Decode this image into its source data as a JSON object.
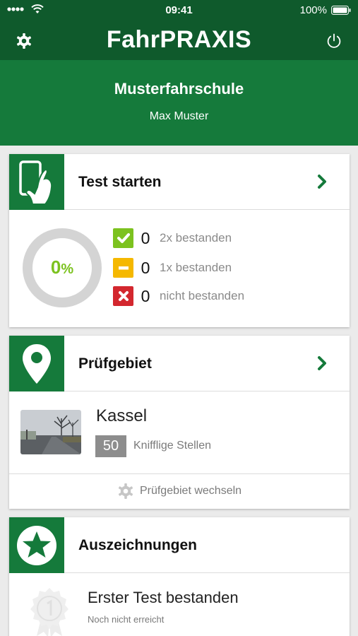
{
  "status_bar": {
    "time": "09:41",
    "battery": "100%"
  },
  "nav": {
    "title": "FahrPRAXIS",
    "settings_icon": "gear-icon",
    "power_icon": "power-icon"
  },
  "header": {
    "school": "Musterfahrschule",
    "user": "Max Muster"
  },
  "test_card": {
    "title": "Test starten",
    "icon": "hand-tablet-icon",
    "progress": {
      "value": 0,
      "unit": "%"
    },
    "stats": [
      {
        "count": "0",
        "label": "2x bestanden",
        "color": "#7cc21f",
        "icon": "check-icon"
      },
      {
        "count": "0",
        "label": "1x bestanden",
        "color": "#f5b800",
        "icon": "minus-icon"
      },
      {
        "count": "0",
        "label": "nicht bestanden",
        "color": "#d3272e",
        "icon": "x-icon"
      }
    ]
  },
  "area_card": {
    "title": "Prüfgebiet",
    "icon": "map-pin-icon",
    "city": "Kassel",
    "count": "50",
    "count_label": "Knifflige Stellen",
    "switch_label": "Prüfgebiet wechseln"
  },
  "awards_card": {
    "title": "Auszeichnungen",
    "icon": "star-badge-icon",
    "award_title": "Erster Test bestanden",
    "award_status": "Noch nicht erreicht"
  },
  "colors": {
    "dark_green": "#0f5a2c",
    "green": "#157a3b",
    "ring_bg": "#d4d4d4",
    "progress_text": "#7cc21f"
  }
}
